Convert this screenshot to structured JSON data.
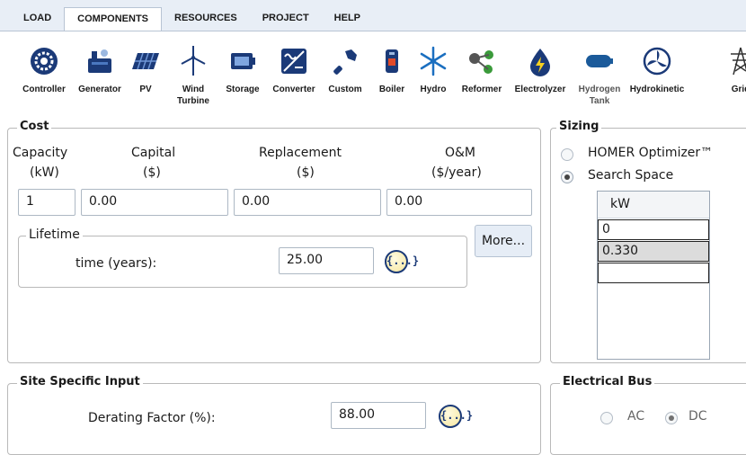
{
  "tabs": [
    "LOAD",
    "COMPONENTS",
    "RESOURCES",
    "PROJECT",
    "HELP"
  ],
  "active_tab": "COMPONENTS",
  "components": [
    {
      "label": "Controller",
      "icon": "controller-icon"
    },
    {
      "label": "Generator",
      "icon": "generator-icon"
    },
    {
      "label": "PV",
      "icon": "pv-panel-icon"
    },
    {
      "label": "Wind Turbine",
      "icon": "wind-turbine-icon"
    },
    {
      "label": "Storage",
      "icon": "storage-battery-icon"
    },
    {
      "label": "Converter",
      "icon": "converter-icon"
    },
    {
      "label": "Custom",
      "icon": "custom-icon"
    },
    {
      "label": "Boiler",
      "icon": "boiler-icon"
    },
    {
      "label": "Hydro",
      "icon": "hydro-icon"
    },
    {
      "label": "Reformer",
      "icon": "reformer-icon"
    },
    {
      "label": "Electrolyzer",
      "icon": "electrolyzer-icon"
    },
    {
      "label": "Hydrogen Tank",
      "icon": "hydrogen-tank-icon"
    },
    {
      "label": "Hydrokinetic",
      "icon": "hydrokinetic-icon"
    },
    {
      "label": "Grid",
      "icon": "grid-tower-icon"
    }
  ],
  "cost": {
    "title": "Cost",
    "headers": {
      "capacity": "Capacity",
      "capacity_unit": "(kW)",
      "capital": "Capital",
      "capital_unit": "($)",
      "replacement": "Replacement",
      "replacement_unit": "($)",
      "om": "O&M",
      "om_unit": "($/year)"
    },
    "values": {
      "capacity": "1",
      "capital": "0.00",
      "replacement": "0.00",
      "om": "0.00"
    },
    "lifetime": {
      "title": "Lifetime",
      "label": "time (years):",
      "value": "25.00"
    },
    "more_button": "More...",
    "sensitivity_icon": "{...}"
  },
  "sizing": {
    "title": "Sizing",
    "options": [
      "HOMER Optimizer™",
      "Search Space"
    ],
    "selected": "Search Space",
    "grid_header": "kW",
    "grid_values": [
      "0",
      "0.330",
      ""
    ]
  },
  "site": {
    "title": "Site Specific Input",
    "derating_label": "Derating Factor (%):",
    "derating_value": "88.00",
    "sensitivity_icon": "{...}"
  },
  "bus": {
    "title": "Electrical Bus",
    "options": [
      "AC",
      "DC"
    ],
    "selected": "DC"
  },
  "colors": {
    "accent": "#1b3a78",
    "ribbon": "#e8eef6"
  }
}
